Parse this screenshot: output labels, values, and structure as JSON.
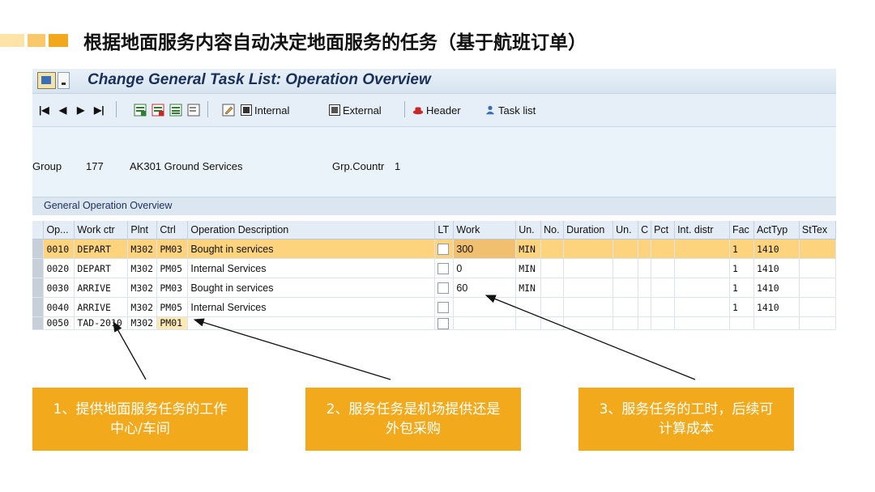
{
  "slide": {
    "title": "根据地面服务内容自动决定地面服务的任务（基于航班订单）"
  },
  "window": {
    "title": "Change General Task List: Operation Overview"
  },
  "toolbar": {
    "internal_label": "Internal",
    "external_label": "External",
    "header_label": "Header",
    "task_list_label": "Task list"
  },
  "header": {
    "group_label": "Group",
    "group_value": "177",
    "description": "AK301 Ground Services",
    "grp_counter_label": "Grp.Countr",
    "grp_counter_value": "1"
  },
  "section": {
    "title": "General Operation Overview"
  },
  "table": {
    "columns": [
      "Op...",
      "Work ctr",
      "Plnt",
      "Ctrl",
      "Operation Description",
      "LT",
      "Work",
      "Un.",
      "No.",
      "Duration",
      "Un.",
      "C",
      "Pct",
      "Int. distr",
      "Fac",
      "ActTyp",
      "StTex"
    ],
    "rows": [
      {
        "op": "0010",
        "work_ctr": "DEPART",
        "plnt": "M302",
        "ctrl": "PM03",
        "desc": "Bought in services",
        "work": "300",
        "unit": "MIN",
        "fac": "1",
        "acttyp": "1410"
      },
      {
        "op": "0020",
        "work_ctr": "DEPART",
        "plnt": "M302",
        "ctrl": "PM05",
        "desc": "Internal Services",
        "work": "0",
        "unit": "MIN",
        "fac": "1",
        "acttyp": "1410"
      },
      {
        "op": "0030",
        "work_ctr": "ARRIVE",
        "plnt": "M302",
        "ctrl": "PM03",
        "desc": "Bought in services",
        "work": "60",
        "unit": "MIN",
        "fac": "1",
        "acttyp": "1410"
      },
      {
        "op": "0040",
        "work_ctr": "ARRIVE",
        "plnt": "M302",
        "ctrl": "PM05",
        "desc": "Internal Services",
        "work": "",
        "unit": "",
        "fac": "1",
        "acttyp": "1410"
      },
      {
        "op": "0050",
        "work_ctr": "TAD-2010",
        "plnt": "M302",
        "ctrl": "PM01",
        "desc": "",
        "work": "",
        "unit": "",
        "fac": "",
        "acttyp": ""
      }
    ]
  },
  "callouts": [
    {
      "line1": "1、提供地面服务任务的工作",
      "line2": "中心/车间"
    },
    {
      "line1": "2、服务任务是机场提供还是",
      "line2": "外包采购"
    },
    {
      "line1": "3、服务任务的工时，后续可",
      "line2": "计算成本"
    }
  ],
  "colors": {
    "accent": "#f2aa1c",
    "highlight_row": "#fdd37d",
    "sap_title": "#1b2f5b"
  }
}
